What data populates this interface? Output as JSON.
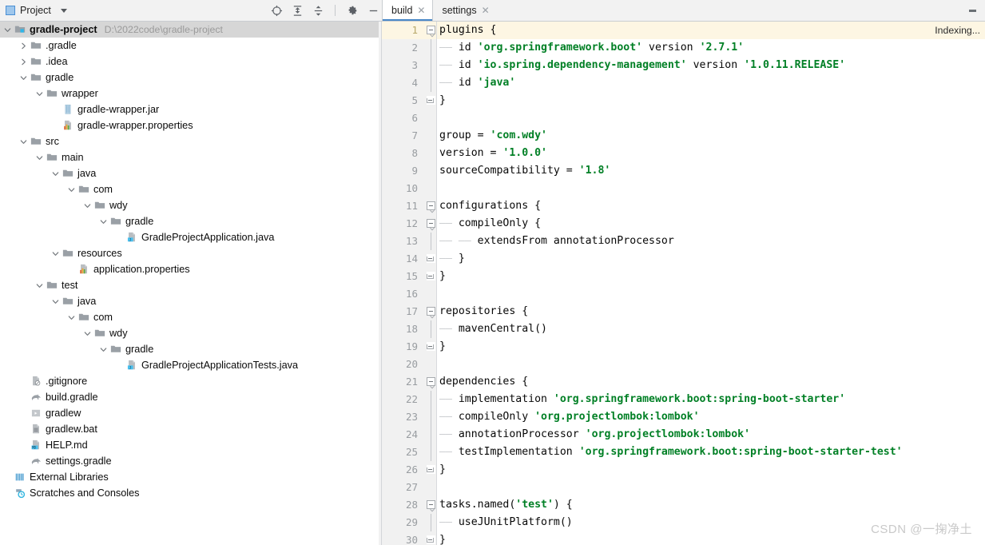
{
  "toolwindow": {
    "title": "Project",
    "dropdown_icon": "chevron-down-icon",
    "icons": [
      {
        "name": "locate-target-icon",
        "title": "Select Opened File"
      },
      {
        "name": "expand-all-icon",
        "title": "Expand All"
      },
      {
        "name": "collapse-all-icon",
        "title": "Collapse All"
      },
      {
        "name": "gear-icon",
        "title": "Settings"
      },
      {
        "name": "minimize-icon",
        "title": "Hide"
      }
    ]
  },
  "editor_tabs": {
    "items": [
      {
        "label": "build",
        "active": true,
        "close_icon": "close-icon"
      },
      {
        "label": "settings",
        "active": false,
        "close_icon": "close-icon"
      }
    ],
    "overflow_icon": "more-vertical-icon"
  },
  "status": {
    "indexing": "Indexing..."
  },
  "watermark": "CSDN @一掬净土",
  "colors": {
    "accent": "#4a88c7",
    "string_literal": "#028026",
    "caret_line": "#fdf6e3",
    "selected_row": "#d6d6d6",
    "folder": "#9aa0a6"
  },
  "project_tree": [
    {
      "depth": 0,
      "label": "gradle-project",
      "path": "D:\\2022code\\gradle-project",
      "icon": "project-module-icon",
      "arrow": "expanded",
      "selected": true
    },
    {
      "depth": 1,
      "label": ".gradle",
      "icon": "folder-icon",
      "arrow": "collapsed"
    },
    {
      "depth": 1,
      "label": ".idea",
      "icon": "folder-icon",
      "arrow": "collapsed"
    },
    {
      "depth": 1,
      "label": "gradle",
      "icon": "folder-icon",
      "arrow": "expanded"
    },
    {
      "depth": 2,
      "label": "wrapper",
      "icon": "folder-icon",
      "arrow": "expanded"
    },
    {
      "depth": 3,
      "label": "gradle-wrapper.jar",
      "icon": "jar-file-icon",
      "arrow": "none"
    },
    {
      "depth": 3,
      "label": "gradle-wrapper.properties",
      "icon": "properties-file-icon",
      "arrow": "none"
    },
    {
      "depth": 1,
      "label": "src",
      "icon": "folder-icon",
      "arrow": "expanded"
    },
    {
      "depth": 2,
      "label": "main",
      "icon": "folder-icon",
      "arrow": "expanded"
    },
    {
      "depth": 3,
      "label": "java",
      "icon": "source-folder-icon",
      "arrow": "expanded"
    },
    {
      "depth": 4,
      "label": "com",
      "icon": "package-folder-icon",
      "arrow": "expanded"
    },
    {
      "depth": 5,
      "label": "wdy",
      "icon": "package-folder-icon",
      "arrow": "expanded"
    },
    {
      "depth": 6,
      "label": "gradle",
      "icon": "package-folder-icon",
      "arrow": "expanded"
    },
    {
      "depth": 7,
      "label": "GradleProjectApplication.java",
      "icon": "java-class-icon",
      "arrow": "none"
    },
    {
      "depth": 3,
      "label": "resources",
      "icon": "resources-folder-icon",
      "arrow": "expanded"
    },
    {
      "depth": 4,
      "label": "application.properties",
      "icon": "properties-file-icon",
      "arrow": "none"
    },
    {
      "depth": 2,
      "label": "test",
      "icon": "folder-icon",
      "arrow": "expanded"
    },
    {
      "depth": 3,
      "label": "java",
      "icon": "test-source-folder-icon",
      "arrow": "expanded"
    },
    {
      "depth": 4,
      "label": "com",
      "icon": "package-folder-icon",
      "arrow": "expanded"
    },
    {
      "depth": 5,
      "label": "wdy",
      "icon": "package-folder-icon",
      "arrow": "expanded"
    },
    {
      "depth": 6,
      "label": "gradle",
      "icon": "package-folder-icon",
      "arrow": "expanded"
    },
    {
      "depth": 7,
      "label": "GradleProjectApplicationTests.java",
      "icon": "java-class-icon",
      "arrow": "none"
    },
    {
      "depth": 1,
      "label": ".gitignore",
      "icon": "gitignore-file-icon",
      "arrow": "none"
    },
    {
      "depth": 1,
      "label": "build.gradle",
      "icon": "gradle-file-icon",
      "arrow": "none"
    },
    {
      "depth": 1,
      "label": "gradlew",
      "icon": "shell-script-icon",
      "arrow": "none"
    },
    {
      "depth": 1,
      "label": "gradlew.bat",
      "icon": "bat-file-icon",
      "arrow": "none"
    },
    {
      "depth": 1,
      "label": "HELP.md",
      "icon": "markdown-file-icon",
      "arrow": "none"
    },
    {
      "depth": 1,
      "label": "settings.gradle",
      "icon": "gradle-file-icon",
      "arrow": "none"
    },
    {
      "depth": 0,
      "label": "External Libraries",
      "icon": "library-icon",
      "arrow": "none"
    },
    {
      "depth": 0,
      "label": "Scratches and Consoles",
      "icon": "scratches-icon",
      "arrow": "none"
    }
  ],
  "code": {
    "filename": "build.gradle",
    "current_line": 1,
    "lines": [
      {
        "n": 1,
        "fold": "open",
        "text": "plugins {",
        "tokens": [
          {
            "t": "plugins {"
          }
        ]
      },
      {
        "n": 2,
        "fold": "bar",
        "tokens": [
          {
            "d": "—— "
          },
          {
            "t": "id "
          },
          {
            "s": "'org.springframework.boot'"
          },
          {
            "t": " version "
          },
          {
            "s": "'2.7.1'"
          }
        ]
      },
      {
        "n": 3,
        "fold": "bar",
        "tokens": [
          {
            "d": "—— "
          },
          {
            "t": "id "
          },
          {
            "s": "'io.spring.dependency-management'"
          },
          {
            "t": " version "
          },
          {
            "s": "'1.0.11.RELEASE'"
          }
        ]
      },
      {
        "n": 4,
        "fold": "bar",
        "tokens": [
          {
            "d": "—— "
          },
          {
            "t": "id "
          },
          {
            "s": "'java'"
          }
        ]
      },
      {
        "n": 5,
        "fold": "end",
        "tokens": [
          {
            "t": "}"
          }
        ]
      },
      {
        "n": 6,
        "fold": "none",
        "tokens": []
      },
      {
        "n": 7,
        "fold": "none",
        "tokens": [
          {
            "t": "group = "
          },
          {
            "s": "'com.wdy'"
          }
        ]
      },
      {
        "n": 8,
        "fold": "none",
        "tokens": [
          {
            "t": "version = "
          },
          {
            "s": "'1.0.0'"
          }
        ]
      },
      {
        "n": 9,
        "fold": "none",
        "tokens": [
          {
            "t": "sourceCompatibility = "
          },
          {
            "s": "'1.8'"
          }
        ]
      },
      {
        "n": 10,
        "fold": "none",
        "tokens": []
      },
      {
        "n": 11,
        "fold": "open",
        "tokens": [
          {
            "t": "configurations {"
          }
        ]
      },
      {
        "n": 12,
        "fold": "open2",
        "tokens": [
          {
            "d": "—— "
          },
          {
            "t": "compileOnly {"
          }
        ]
      },
      {
        "n": 13,
        "fold": "bar",
        "tokens": [
          {
            "d": "—— —— "
          },
          {
            "t": "extendsFrom annotationProcessor"
          }
        ]
      },
      {
        "n": 14,
        "fold": "end2",
        "tokens": [
          {
            "d": "—— "
          },
          {
            "t": "}"
          }
        ]
      },
      {
        "n": 15,
        "fold": "end",
        "tokens": [
          {
            "t": "}"
          }
        ]
      },
      {
        "n": 16,
        "fold": "none",
        "tokens": []
      },
      {
        "n": 17,
        "fold": "open",
        "tokens": [
          {
            "t": "repositories {"
          }
        ]
      },
      {
        "n": 18,
        "fold": "bar",
        "tokens": [
          {
            "d": "—— "
          },
          {
            "t": "mavenCentral()"
          }
        ]
      },
      {
        "n": 19,
        "fold": "end",
        "tokens": [
          {
            "t": "}"
          }
        ]
      },
      {
        "n": 20,
        "fold": "none",
        "tokens": []
      },
      {
        "n": 21,
        "fold": "open",
        "tokens": [
          {
            "t": "dependencies {"
          }
        ]
      },
      {
        "n": 22,
        "fold": "bar",
        "tokens": [
          {
            "d": "—— "
          },
          {
            "t": "implementation "
          },
          {
            "s": "'org.springframework.boot:spring-boot-starter'"
          }
        ]
      },
      {
        "n": 23,
        "fold": "bar",
        "tokens": [
          {
            "d": "—— "
          },
          {
            "t": "compileOnly "
          },
          {
            "s": "'org.projectlombok:lombok'"
          }
        ]
      },
      {
        "n": 24,
        "fold": "bar",
        "tokens": [
          {
            "d": "—— "
          },
          {
            "t": "annotationProcessor "
          },
          {
            "s": "'org.projectlombok:lombok'"
          }
        ]
      },
      {
        "n": 25,
        "fold": "bar",
        "tokens": [
          {
            "d": "—— "
          },
          {
            "t": "testImplementation "
          },
          {
            "s": "'org.springframework.boot:spring-boot-starter-test'"
          }
        ]
      },
      {
        "n": 26,
        "fold": "end",
        "tokens": [
          {
            "t": "}"
          }
        ]
      },
      {
        "n": 27,
        "fold": "none",
        "tokens": []
      },
      {
        "n": 28,
        "fold": "open",
        "tokens": [
          {
            "t": "tasks.named("
          },
          {
            "s": "'test'"
          },
          {
            "t": ") {"
          }
        ]
      },
      {
        "n": 29,
        "fold": "bar",
        "tokens": [
          {
            "d": "—— "
          },
          {
            "t": "useJUnitPlatform()"
          }
        ]
      },
      {
        "n": 30,
        "fold": "end",
        "tokens": [
          {
            "t": "}"
          }
        ]
      }
    ]
  }
}
